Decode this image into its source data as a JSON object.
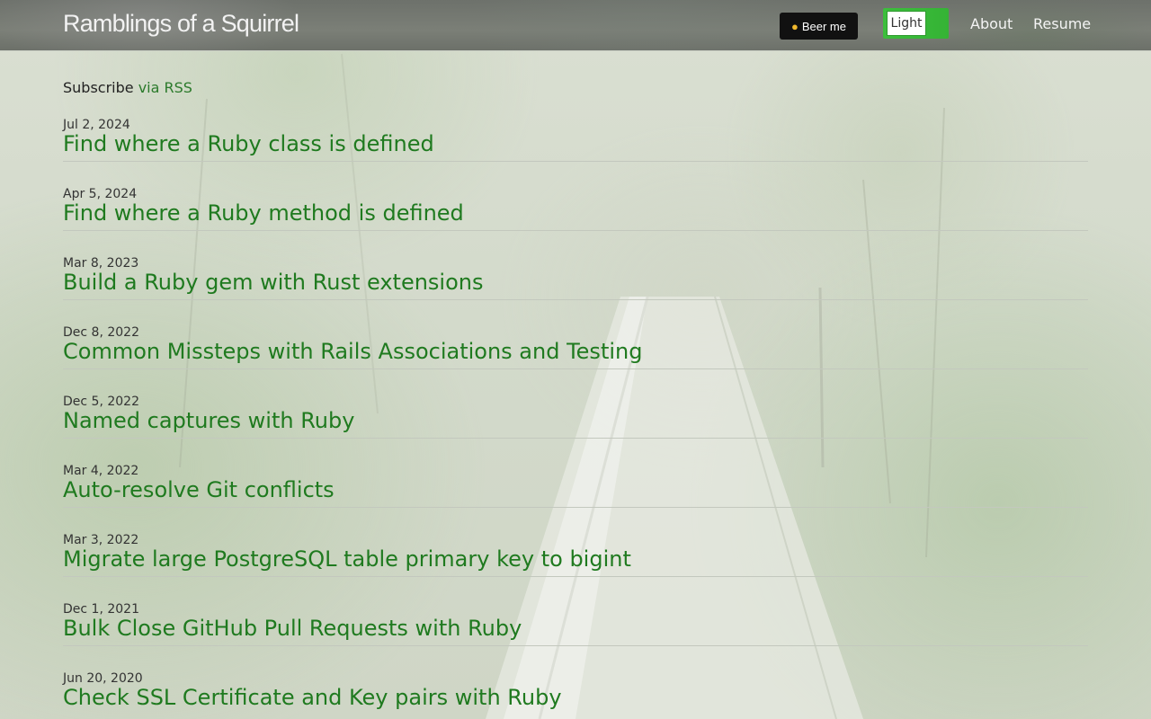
{
  "header": {
    "site_title": "Ramblings of a Squirrel",
    "beer_button_label": "Beer me",
    "beer_icon": "beer-mug-icon",
    "theme_toggle_label": "Light",
    "nav": [
      {
        "label": "About"
      },
      {
        "label": "Resume"
      }
    ]
  },
  "subscribe": {
    "prefix": "Subscribe",
    "link_label": "via RSS"
  },
  "posts": [
    {
      "date": "Jul 2, 2024",
      "title": "Find where a Ruby class is defined"
    },
    {
      "date": "Apr 5, 2024",
      "title": "Find where a Ruby method is defined"
    },
    {
      "date": "Mar 8, 2023",
      "title": "Build a Ruby gem with Rust extensions"
    },
    {
      "date": "Dec 8, 2022",
      "title": "Common Missteps with Rails Associations and Testing"
    },
    {
      "date": "Dec 5, 2022",
      "title": "Named captures with Ruby"
    },
    {
      "date": "Mar 4, 2022",
      "title": "Auto-resolve Git conflicts"
    },
    {
      "date": "Mar 3, 2022",
      "title": "Migrate large PostgreSQL table primary key to bigint"
    },
    {
      "date": "Dec 1, 2021",
      "title": "Bulk Close GitHub Pull Requests with Ruby"
    },
    {
      "date": "Jun 20, 2020",
      "title": "Check SSL Certificate and Key pairs with Ruby"
    }
  ],
  "colors": {
    "link_green": "#1f7a1f",
    "toggle_green": "#3cbe3c",
    "header_gray": "#747872"
  }
}
